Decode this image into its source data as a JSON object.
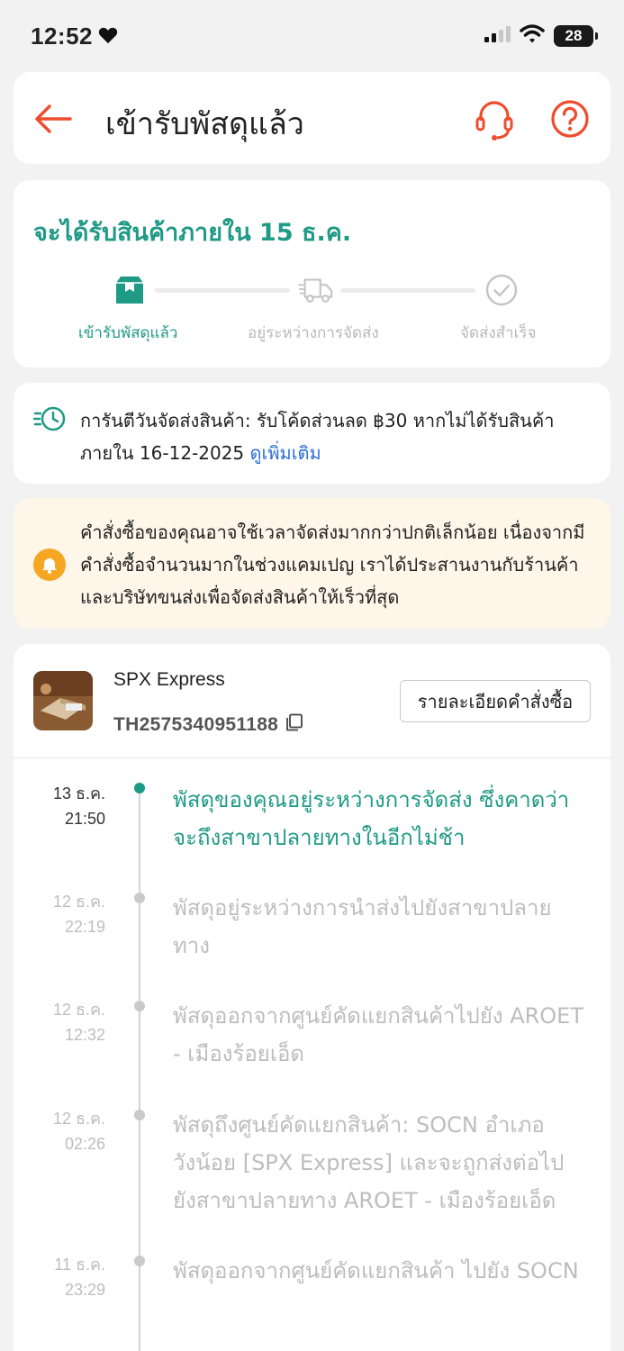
{
  "status_bar": {
    "time": "12:52",
    "battery": "28"
  },
  "header": {
    "title": "เข้ารับพัสดุแล้ว"
  },
  "eta": {
    "title": "จะได้รับสินค้าภายใน 15 ธ.ค.",
    "steps": [
      {
        "label": "เข้ารับพัสดุแล้ว",
        "icon": "package-icon",
        "active": true
      },
      {
        "label": "อยู่ระหว่างการจัดส่ง",
        "icon": "truck-icon",
        "active": false
      },
      {
        "label": "จัดส่งสำเร็จ",
        "icon": "check-circle-icon",
        "active": false
      }
    ]
  },
  "guarantee": {
    "text": "การันตีวันจัดส่งสินค้า: รับโค้ดส่วนลด ฿30 หากไม่ได้รับสินค้าภายใน 16-12-2025 ",
    "link": "ดูเพิ่มเติม"
  },
  "notice": {
    "text": "คำสั่งซื้อของคุณอาจใช้เวลาจัดส่งมากกว่าปกติเล็กน้อย เนื่องจากมีคำสั่งซื้อจำนวนมากในช่วงแคมเปญ เราได้ประสานงานกับร้านค้าและบริษัทขนส่งเพื่อจัดส่งสินค้าให้เร็วที่สุด"
  },
  "shipment": {
    "courier": "SPX Express",
    "tracking_number": "TH2575340951188",
    "details_button": "รายละเอียดคำสั่งซื้อ"
  },
  "timeline": [
    {
      "date": "13 ธ.ค.",
      "time": "21:50",
      "text": "พัสดุของคุณอยู่ระหว่างการจัดส่ง ซึ่งคาดว่าจะถึงสาขาปลายทางในอีกไม่ช้า",
      "active": true
    },
    {
      "date": "12 ธ.ค.",
      "time": "22:19",
      "text": "พัสดุอยู่ระหว่างการนำส่งไปยังสาขาปลายทาง",
      "active": false
    },
    {
      "date": "12 ธ.ค.",
      "time": "12:32",
      "text": "พัสดุออกจากศูนย์คัดแยกสินค้าไปยัง AROET - เมืองร้อยเอ็ด",
      "active": false
    },
    {
      "date": "12 ธ.ค.",
      "time": "02:26",
      "text": "พัสดุถึงศูนย์คัดแยกสินค้า: SOCN อำเภอวังน้อย [SPX Express] และจะถูกส่งต่อไปยังสาขาปลายทาง AROET - เมืองร้อยเอ็ด",
      "active": false
    },
    {
      "date": "11 ธ.ค.",
      "time": "23:29",
      "text": "พัสดุออกจากศูนย์คัดแยกสินค้า ไปยัง SOCN",
      "active": false
    }
  ],
  "colors": {
    "accent": "#1f9a86",
    "brand_orange": "#ee4d2d",
    "link": "#2a6fd6",
    "notice_bg": "#fdf6e9"
  }
}
